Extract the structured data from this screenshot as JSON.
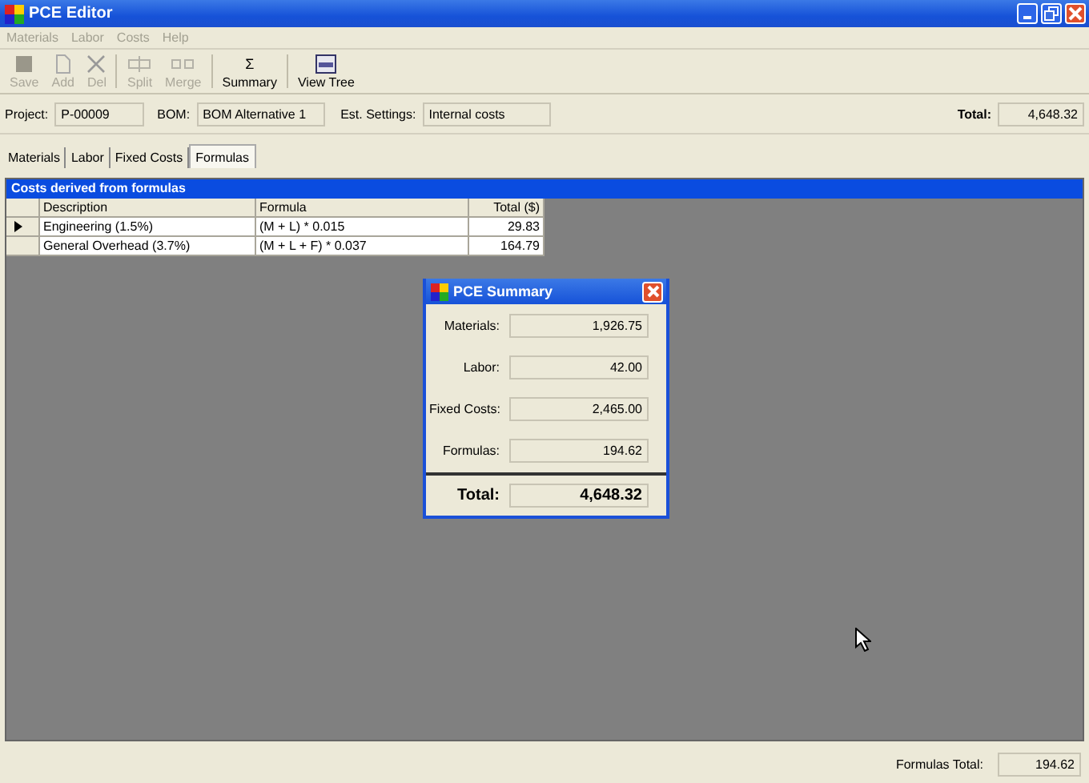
{
  "window": {
    "title": "PCE Editor"
  },
  "menu": [
    {
      "label": "Materials",
      "disabled": true
    },
    {
      "label": "Labor",
      "disabled": true
    },
    {
      "label": "Costs",
      "disabled": true
    },
    {
      "label": "Help",
      "disabled": true
    }
  ],
  "toolbar": [
    {
      "kind": "save",
      "label": "Save",
      "disabled": true
    },
    {
      "kind": "page",
      "label": "Add",
      "disabled": true
    },
    {
      "kind": "cross",
      "label": "Del",
      "disabled": true
    },
    {
      "kind": "split",
      "label": "Split",
      "disabled": true
    },
    {
      "kind": "merge",
      "label": "Merge",
      "disabled": true
    },
    {
      "kind": "sigma",
      "glyph": "Σ",
      "label": "Summary",
      "disabled": false
    },
    {
      "kind": "monitor",
      "label": "View Tree",
      "disabled": false
    }
  ],
  "fields": [
    {
      "label": "Project:",
      "value": "P-00009"
    },
    {
      "label": "BOM:",
      "value": "BOM Alternative 1"
    },
    {
      "label": "Est. Settings:",
      "value": "Internal costs"
    }
  ],
  "total": {
    "label": "Total:",
    "value": "4,648.32"
  },
  "tabs": [
    {
      "label": "Materials",
      "selected": false
    },
    {
      "label": "Labor",
      "selected": false
    },
    {
      "label": "Fixed Costs",
      "selected": false
    },
    {
      "label": "Formulas",
      "selected": true
    }
  ],
  "grid": {
    "caption": "Costs derived from formulas",
    "columns": [
      "Description",
      "Formula",
      "Total ($)"
    ],
    "rows": [
      {
        "cells": [
          "Engineering (1.5%)",
          "(M + L) * 0.015",
          "29.83"
        ],
        "selected": true
      },
      {
        "cells": [
          "General Overhead (3.7%)",
          "(M + L + F) * 0.037",
          "164.79"
        ],
        "selected": false
      }
    ]
  },
  "dialog": {
    "title": "PCE Summary",
    "items": [
      {
        "label": "Materials:",
        "value": "1,926.75"
      },
      {
        "label": "Labor:",
        "value": "42.00"
      },
      {
        "label": "Fixed Costs:",
        "value": "2,465.00"
      },
      {
        "label": "Formulas:",
        "value": "194.62"
      }
    ],
    "total": {
      "label": "Total:",
      "value": "4,648.32"
    }
  },
  "footer": {
    "label": "Formulas Total:",
    "value": "194.62"
  }
}
